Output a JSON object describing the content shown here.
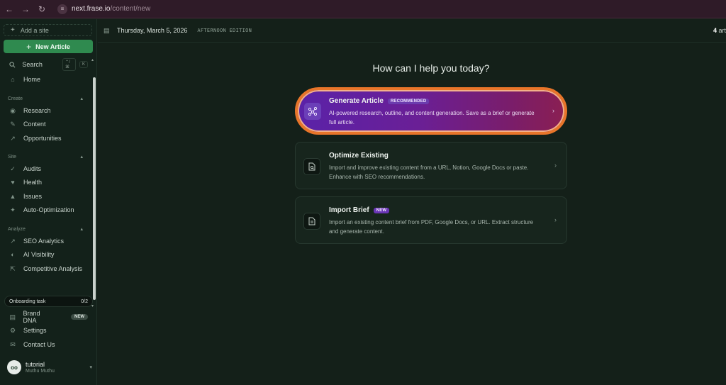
{
  "browser": {
    "url_host": "next.frase.io",
    "url_path": "/content/new"
  },
  "sidebar": {
    "add_site": "Add a site",
    "new_article": "New Article",
    "search": {
      "label": "Search",
      "shortcut": "⌃/⌘",
      "shortcut2": "K"
    },
    "home": "Home",
    "sections": {
      "create": "Create",
      "site": "Site",
      "analyze": "Analyze"
    },
    "create_items": [
      "Research",
      "Content",
      "Opportunities"
    ],
    "site_items": [
      "Audits",
      "Health",
      "Issues",
      "Auto-Optimization"
    ],
    "analyze_items": [
      "SEO Analytics",
      "AI Visibility",
      "Competitive Analysis"
    ],
    "onboarding": {
      "label": "Onboarding task",
      "progress": "0/2"
    },
    "brand_dna": {
      "label": "Brand DNA",
      "badge": "NEW"
    },
    "settings": "Settings",
    "contact": "Contact Us",
    "user": {
      "name": "tutorial",
      "sub": "Muthu Muthu"
    }
  },
  "header": {
    "date": "Thursday, March 5, 2026",
    "edition": "AFTERNOON EDITION",
    "count": "4",
    "count_suffix": "art"
  },
  "main": {
    "heading": "How can I help you today?",
    "cards": [
      {
        "title": "Generate Article",
        "badge": "RECOMMENDED",
        "description": "AI-powered research, outline, and content generation. Save as a brief or generate full article."
      },
      {
        "title": "Optimize Existing",
        "badge": "",
        "description": "Import and improve existing content from a URL, Notion, Google Docs or paste. Enhance with SEO recommendations."
      },
      {
        "title": "Import Brief",
        "badge": "NEW",
        "description": "Import an existing content brief from PDF, Google Docs, or URL. Extract structure and generate content."
      }
    ]
  },
  "colors": {
    "accent": "#2f8a4f",
    "highlight_ring": "#e8752a",
    "featured_start": "#5a22a8",
    "featured_end": "#8a1f52",
    "background": "#142019"
  }
}
